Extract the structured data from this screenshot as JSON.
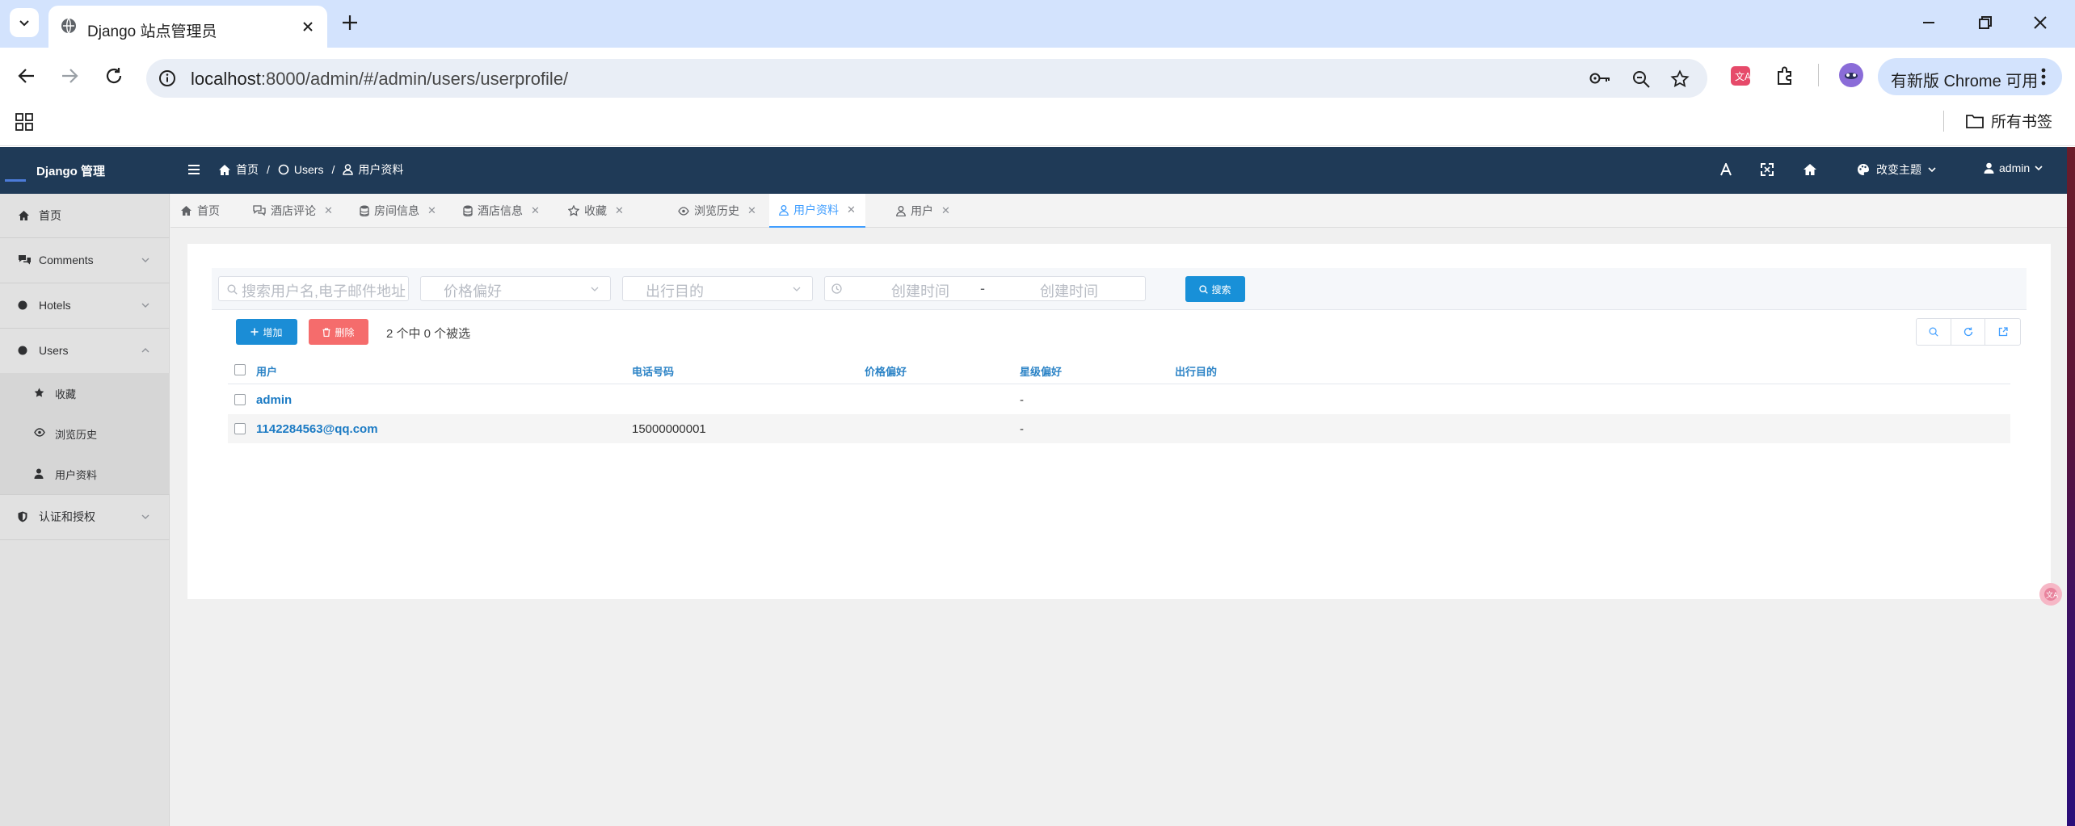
{
  "browser": {
    "tab_title": "Django 站点管理员",
    "url_host": "localhost",
    "url_rest": ":8000/admin/#/admin/users/userprofile/",
    "update_label": "有新版 Chrome 可用",
    "all_bookmarks": "所有书签"
  },
  "admin": {
    "logo": "Django 管理",
    "breadcrumb": [
      "首页",
      "/",
      "Users",
      "/",
      "用户资料"
    ],
    "theme_label": "改变主题",
    "user_label": "admin"
  },
  "sidebar": {
    "items": [
      {
        "label": "首页",
        "icon": "home-icon"
      },
      {
        "label": "Comments",
        "icon": "comments-icon"
      },
      {
        "label": "Hotels",
        "icon": "dot-icon"
      },
      {
        "label": "Users",
        "icon": "dot-icon"
      }
    ],
    "users_children": [
      {
        "label": "收藏",
        "icon": "star-icon"
      },
      {
        "label": "浏览历史",
        "icon": "eye-icon"
      },
      {
        "label": "用户资料",
        "icon": "user-icon"
      }
    ],
    "auth": {
      "label": "认证和授权",
      "icon": "shield-icon"
    }
  },
  "tabs": [
    {
      "label": "首页",
      "icon": "home-icon",
      "closable": false
    },
    {
      "label": "酒店评论",
      "icon": "comments-icon",
      "closable": true
    },
    {
      "label": "房间信息",
      "icon": "database-icon",
      "closable": true
    },
    {
      "label": "酒店信息",
      "icon": "database-icon",
      "closable": true
    },
    {
      "label": "收藏",
      "icon": "star-icon",
      "closable": true
    },
    {
      "label": "浏览历史",
      "icon": "eye-icon",
      "closable": true
    },
    {
      "label": "用户资料",
      "icon": "user-icon",
      "closable": true,
      "active": true
    },
    {
      "label": "用户",
      "icon": "user-icon",
      "closable": true
    }
  ],
  "filters": {
    "search_placeholder": "搜索用户名,电子邮件地址...",
    "price_pref_placeholder": "价格偏好",
    "travel_purpose_placeholder": "出行目的",
    "created_from_placeholder": "创建时间",
    "range_sep": "-",
    "created_to_placeholder": "创建时间",
    "search_button": "搜索"
  },
  "actions": {
    "add": "增加",
    "delete": "删除",
    "selection": "2 个中 0 个被选"
  },
  "table": {
    "columns": [
      "用户",
      "电话号码",
      "价格偏好",
      "星级偏好",
      "出行目的"
    ],
    "rows": [
      {
        "user": "admin",
        "phone": "",
        "price": "",
        "star": "-",
        "purpose": ""
      },
      {
        "user": "1142284563@qq.com",
        "phone": "15000000001",
        "price": "",
        "star": "-",
        "purpose": ""
      }
    ]
  },
  "colors": {
    "topnav": "#1f3a57",
    "accent": "#409eff",
    "primary_button": "#1b8dd6",
    "danger_button": "#f56c6c"
  }
}
